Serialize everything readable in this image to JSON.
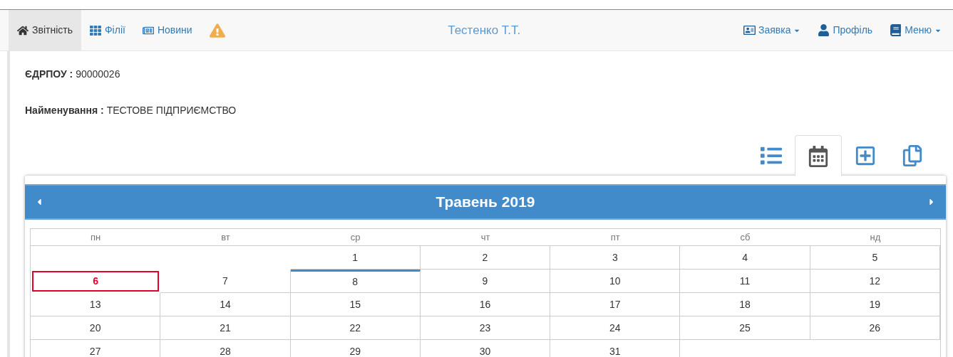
{
  "navbar": {
    "left": [
      {
        "kind": "home",
        "label": "Звітність",
        "selected": true
      },
      {
        "kind": "grid",
        "label": "Філії",
        "selected": false
      },
      {
        "kind": "news",
        "label": "Новини",
        "selected": false
      },
      {
        "kind": "warning",
        "selected": false
      }
    ],
    "user": "Тестенко Т.Т.",
    "right": [
      {
        "kind": "card",
        "label": "Заявка",
        "dropdown": true
      },
      {
        "kind": "user",
        "label": "Профіль",
        "dropdown": false
      },
      {
        "kind": "book",
        "label": "Меню",
        "dropdown": true
      }
    ]
  },
  "info": [
    {
      "label": "ЄДРПОУ :",
      "value": "90000026"
    },
    {
      "label": "Найменування :",
      "value": "ТЕСТОВЕ ПІДПРИЄМСТВО"
    }
  ],
  "view_buttons": [
    {
      "kind": "list",
      "selected": false
    },
    {
      "kind": "calendar",
      "selected": true
    },
    {
      "kind": "add",
      "selected": false
    },
    {
      "kind": "copy",
      "selected": false
    }
  ],
  "calendar": {
    "title": "Травень 2019",
    "weekdays": [
      "пн",
      "вт",
      "ср",
      "чт",
      "пт",
      "сб",
      "нд"
    ],
    "weeks": [
      [
        {
          "kind": "empty"
        },
        {
          "kind": "empty"
        },
        {
          "label": "1",
          "today": false,
          "marked": false
        },
        {
          "label": "2",
          "today": false,
          "marked": false
        },
        {
          "label": "3",
          "today": false,
          "marked": false
        },
        {
          "label": "4",
          "today": false,
          "marked": false
        },
        {
          "label": "5",
          "today": false,
          "marked": false
        }
      ],
      [
        {
          "label": "6",
          "today": true,
          "marked": false
        },
        {
          "label": "7",
          "today": false,
          "marked": false
        },
        {
          "label": "8",
          "today": false,
          "marked": true
        },
        {
          "label": "9",
          "today": false,
          "marked": false
        },
        {
          "label": "10",
          "today": false,
          "marked": false
        },
        {
          "label": "11",
          "today": false,
          "marked": false
        },
        {
          "label": "12",
          "today": false,
          "marked": false
        }
      ],
      [
        {
          "label": "13",
          "today": false,
          "marked": false
        },
        {
          "label": "14",
          "today": false,
          "marked": false
        },
        {
          "label": "15",
          "today": false,
          "marked": false
        },
        {
          "label": "16",
          "today": false,
          "marked": false
        },
        {
          "label": "17",
          "today": false,
          "marked": false
        },
        {
          "label": "18",
          "today": false,
          "marked": false
        },
        {
          "label": "19",
          "today": false,
          "marked": false
        }
      ],
      [
        {
          "label": "20",
          "today": false,
          "marked": false
        },
        {
          "label": "21",
          "today": false,
          "marked": false
        },
        {
          "label": "22",
          "today": false,
          "marked": false
        },
        {
          "label": "23",
          "today": false,
          "marked": false
        },
        {
          "label": "24",
          "today": false,
          "marked": false
        },
        {
          "label": "25",
          "today": false,
          "marked": false
        },
        {
          "label": "26",
          "today": false,
          "marked": false
        }
      ],
      [
        {
          "label": "27",
          "today": false,
          "marked": false
        },
        {
          "label": "28",
          "today": false,
          "marked": false
        },
        {
          "label": "29",
          "today": false,
          "marked": false
        },
        {
          "label": "30",
          "today": false,
          "marked": false
        },
        {
          "label": "31",
          "today": false,
          "marked": false
        },
        {
          "kind": "empty"
        },
        {
          "kind": "empty"
        }
      ]
    ]
  }
}
